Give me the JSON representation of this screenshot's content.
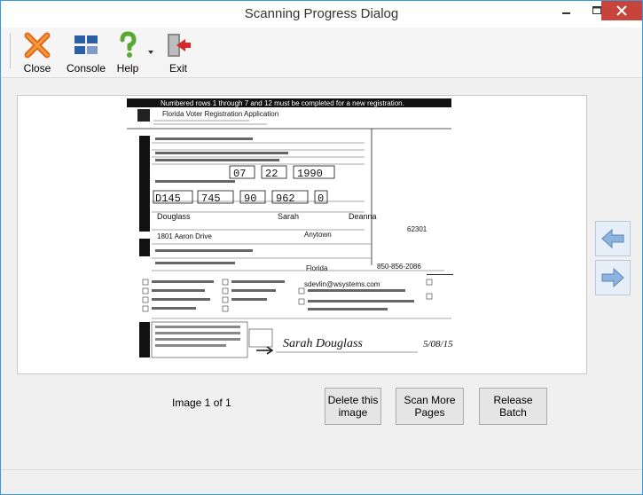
{
  "window": {
    "title": "Scanning Progress Dialog"
  },
  "toolbar": {
    "close_label": "Close",
    "console_label": "Console",
    "help_label": "Help",
    "exit_label": "Exit"
  },
  "document": {
    "banner": "Numbered rows 1 through 7 and 12 must be completed for a new registration.",
    "form_title": "Florida Voter Registration Application",
    "birth_date": [
      "07",
      "22",
      "1990"
    ],
    "license_number": [
      "D145",
      "745",
      "90",
      "962",
      "0"
    ],
    "last_name": "Douglass",
    "first_name": "Sarah",
    "middle_name": "Deanna",
    "address": "1801 Aaron Drive",
    "city": "Anytown",
    "zip": "62301",
    "state": "Florida",
    "email": "sdevlin@wsystems.com",
    "phone": "850-856-2086",
    "signature": "Sarah Douglass",
    "date_signed": "5/08/15"
  },
  "status": {
    "image_counter": "Image 1 of 1"
  },
  "actions": {
    "delete_label": "Delete this\nimage",
    "scan_more_label": "Scan More\nPages",
    "release_label": "Release\nBatch"
  },
  "colors": {
    "accent": "#3a9ad9",
    "close_btn": "#c7443d"
  }
}
